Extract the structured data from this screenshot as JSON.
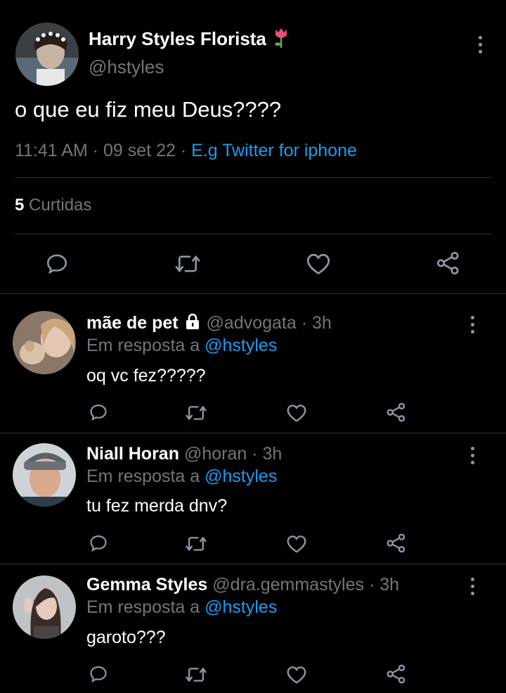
{
  "main_tweet": {
    "display_name": "Harry Styles Florista",
    "name_emoji": "🌷",
    "handle": "@hstyles",
    "text": "o que eu fiz meu Deus????",
    "time": "11:41 AM",
    "date": "09 set 22",
    "source": "E.g Twitter for iphone",
    "likes_count": "5",
    "likes_label": "Curtidas"
  },
  "sep": "·",
  "replies": [
    {
      "display_name": "mãe de pet",
      "handle": "@advogata",
      "time": "3h",
      "reply_prefix": "Em resposta a",
      "reply_to": "@hstyles",
      "text": "oq vc fez?????",
      "locked": true
    },
    {
      "display_name": "Niall Horan",
      "handle": "@horan",
      "time": "3h",
      "reply_prefix": "Em resposta a",
      "reply_to": "@hstyles",
      "text": "tu fez merda dnv?"
    },
    {
      "display_name": "Gemma Styles",
      "handle": "@dra.gemmastyles",
      "time": "3h",
      "reply_prefix": "Em resposta a",
      "reply_to": "@hstyles",
      "text": "garoto???"
    }
  ],
  "colors": {
    "background": "#000000",
    "text": "#e7e9ea",
    "secondary": "#71767b",
    "accent": "#1d9bf0",
    "divider": "#2f3336"
  },
  "icons": [
    "reply-icon",
    "retweet-icon",
    "like-icon",
    "share-icon",
    "more-icon",
    "lock-icon",
    "tulip-emoji"
  ]
}
